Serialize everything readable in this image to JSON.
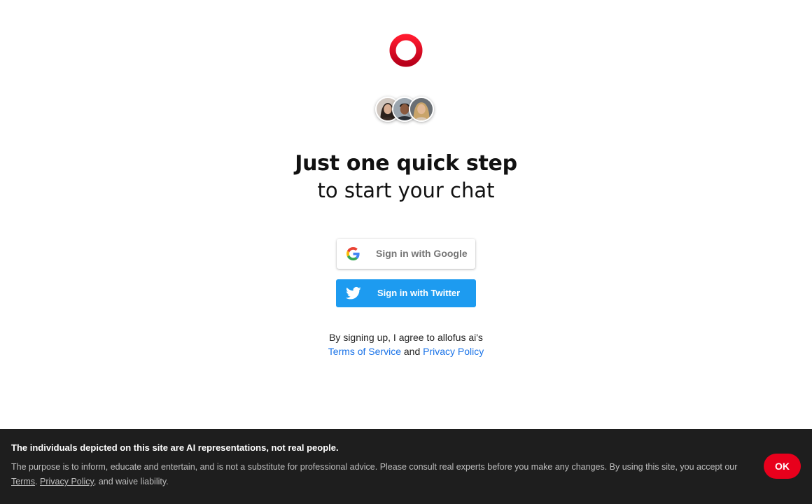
{
  "brand": {
    "logo_icon": "ring-logo-icon",
    "accent": "#e8001c"
  },
  "avatars": [
    "avatar-woman-dark-hair",
    "avatar-man",
    "avatar-woman-blonde"
  ],
  "headline": {
    "line1": "Just one quick step",
    "line2": "to start your chat"
  },
  "auth": {
    "google_label": "Sign in with Google",
    "twitter_label": "Sign in with Twitter",
    "twitter_color": "#1d9bf0"
  },
  "terms": {
    "prefix": "By signing up, I agree to allofus ai's",
    "tos_link": "Terms of Service",
    "and": "and",
    "privacy_link": "Privacy Policy"
  },
  "cookie_bar": {
    "title": "The individuals depicted on this site are AI representations, not real people.",
    "desc_text": "The purpose is to inform, educate and entertain, and is not a substitute for professional advice. Please consult real experts before you make any changes. By using this site, you accept our",
    "terms_link": "Terms",
    "separator": ".",
    "privacy_link": "Privacy Policy",
    "suffix": ", and waive liability.",
    "ok_label": "OK"
  }
}
